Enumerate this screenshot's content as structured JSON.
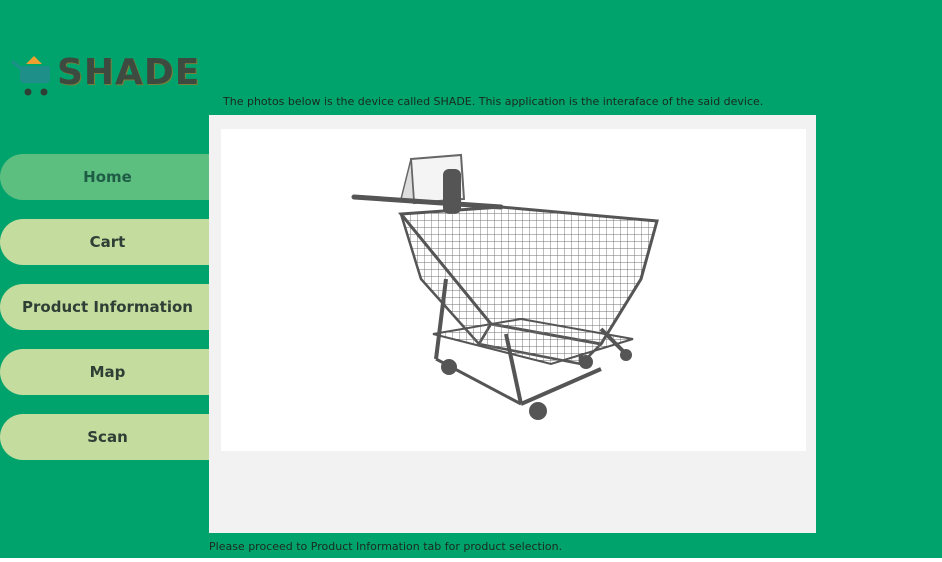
{
  "app": {
    "logo_text": "SHADE"
  },
  "intro": {
    "text": "The photos below is the device called SHADE. This application is the interaface of the said device."
  },
  "footer": {
    "text": "Please proceed to Product Information tab for product selection."
  },
  "nav": {
    "items": [
      {
        "label": "Home",
        "active": true
      },
      {
        "label": "Cart",
        "active": false
      },
      {
        "label": "Product Information",
        "active": false
      },
      {
        "label": "Map",
        "active": false
      },
      {
        "label": "Scan",
        "active": false
      }
    ]
  },
  "icons": {
    "logo": "cart-logo-icon",
    "photo": "shopping-cart-device-image"
  },
  "colors": {
    "background": "#00a36c",
    "nav_active": "#5cbf80",
    "nav_inactive": "#c4dc9e",
    "panel": "#f2f2f2",
    "logo_text": "#3d4a3f",
    "logo_accent": "#f0a030"
  }
}
